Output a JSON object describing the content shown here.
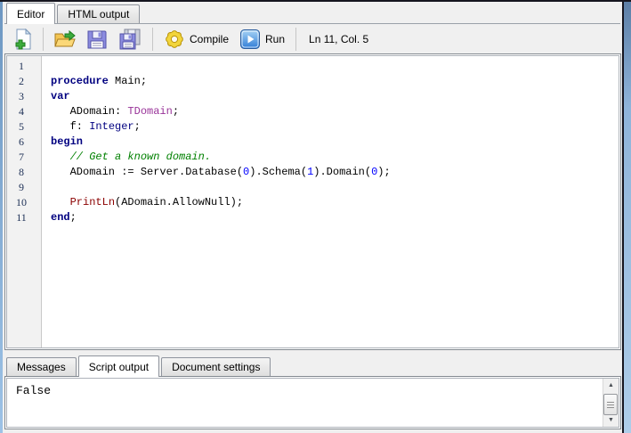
{
  "top_tabs": [
    {
      "label": "Editor",
      "active": true
    },
    {
      "label": "HTML output",
      "active": false
    }
  ],
  "toolbar": {
    "icons": [
      "new-document-icon",
      "open-folder-icon",
      "save-icon",
      "save-all-icon",
      "gear-icon",
      "play-icon"
    ],
    "compile_label": "Compile",
    "run_label": "Run",
    "caret_status": "Ln 11, Col. 5"
  },
  "editor": {
    "line_numbers": [
      "1",
      "2",
      "3",
      "4",
      "5",
      "6",
      "7",
      "8",
      "9",
      "10",
      "11"
    ],
    "palette": {
      "keyword": {
        "color": "#000080",
        "bold": true
      },
      "plain": {
        "color": "#000000"
      },
      "type": {
        "color": "#993399"
      },
      "type_std": {
        "color": "#000080"
      },
      "number": {
        "color": "#0000ff"
      },
      "comment": {
        "color": "#008000",
        "italic": true
      },
      "function": {
        "color": "#8b0000"
      }
    },
    "code_lines": [
      [],
      [
        {
          "text": "procedure",
          "style": "keyword"
        },
        {
          "text": " Main;",
          "style": "plain"
        }
      ],
      [
        {
          "text": "var",
          "style": "keyword"
        }
      ],
      [
        {
          "text": "   ADomain: ",
          "style": "plain"
        },
        {
          "text": "TDomain",
          "style": "type"
        },
        {
          "text": ";",
          "style": "plain"
        }
      ],
      [
        {
          "text": "   f: ",
          "style": "plain"
        },
        {
          "text": "Integer",
          "style": "type_std"
        },
        {
          "text": ";",
          "style": "plain"
        }
      ],
      [
        {
          "text": "begin",
          "style": "keyword"
        }
      ],
      [
        {
          "text": "   // Get a known domain.",
          "style": "comment"
        }
      ],
      [
        {
          "text": "   ADomain := Server.Database(",
          "style": "plain"
        },
        {
          "text": "0",
          "style": "number"
        },
        {
          "text": ").Schema(",
          "style": "plain"
        },
        {
          "text": "1",
          "style": "number"
        },
        {
          "text": ").Domain(",
          "style": "plain"
        },
        {
          "text": "0",
          "style": "number"
        },
        {
          "text": ");",
          "style": "plain"
        }
      ],
      [],
      [
        {
          "text": "   ",
          "style": "plain"
        },
        {
          "text": "PrintLn",
          "style": "function"
        },
        {
          "text": "(ADomain.AllowNull);",
          "style": "plain"
        }
      ],
      [
        {
          "text": "end",
          "style": "keyword"
        },
        {
          "text": ";",
          "style": "plain"
        }
      ]
    ]
  },
  "bottom_tabs": [
    {
      "label": "Messages",
      "active": false
    },
    {
      "label": "Script output",
      "active": true
    },
    {
      "label": "Document settings",
      "active": false
    }
  ],
  "output": {
    "text": "False"
  },
  "colors": {
    "window_bg": "#f0f0f0",
    "chrome_blue": "#8fb4da",
    "panel_border": "#838990",
    "gutter_bg": "#f2f2f2",
    "gutter_number": "#1c2f55"
  }
}
